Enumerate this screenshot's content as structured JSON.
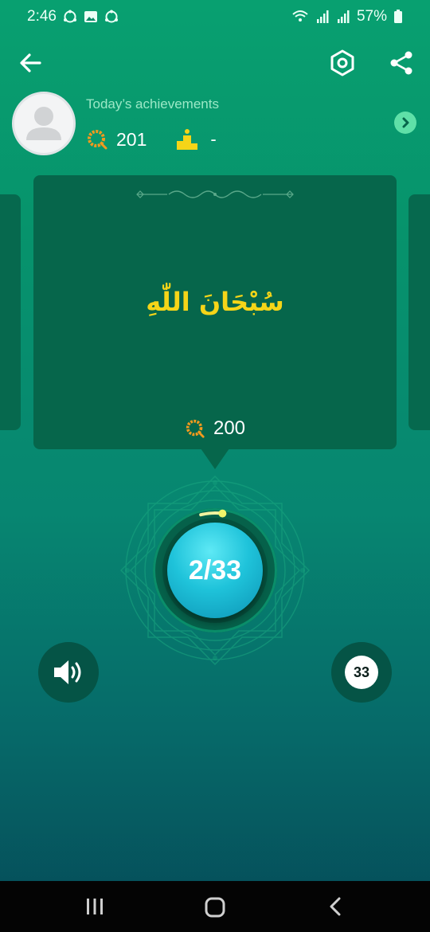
{
  "status_bar": {
    "time": "2:46",
    "battery": "57%",
    "left_icons": [
      "sync-icon",
      "gallery-icon",
      "sync-icon"
    ],
    "right_icons": [
      "wifi-icon",
      "signal-icon",
      "signal-icon",
      "battery-icon"
    ]
  },
  "header": {
    "back_icon": "arrow-left-icon",
    "settings_icon": "hexagon-settings-icon",
    "share_icon": "share-icon"
  },
  "profile": {
    "achievements_label": "Today’s achievements",
    "tasbih_count": "201",
    "rank_value": "-",
    "colors": {
      "label": "#9be8c6",
      "accent_button": "#5fe0a8"
    }
  },
  "dhikr": {
    "arabic": "سُبْحَانَ اللّٰهِ",
    "count": "200",
    "colors": {
      "text": "#f5d518",
      "card": "#06664b"
    }
  },
  "counter": {
    "display": "2/33",
    "progress": 0.0606
  },
  "controls": {
    "sound_icon": "speaker-icon",
    "target": "33"
  },
  "nav": {
    "icons": [
      "recent-apps-icon",
      "home-icon",
      "back-icon"
    ]
  }
}
